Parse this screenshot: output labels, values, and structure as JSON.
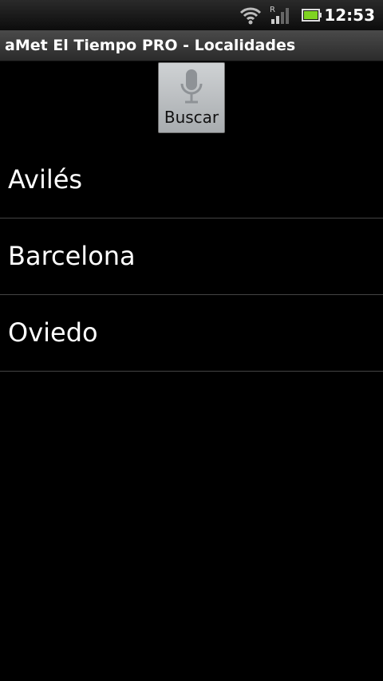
{
  "status_bar": {
    "time": "12:53",
    "icons": [
      "wifi-icon",
      "signal-icon",
      "battery-icon"
    ],
    "signal_label": "R"
  },
  "title_bar": {
    "title": "aMet El Tiempo PRO - Localidades"
  },
  "search": {
    "label": "Buscar",
    "icon": "microphone-icon"
  },
  "locations": [
    {
      "name": "Avilés"
    },
    {
      "name": "Barcelona"
    },
    {
      "name": "Oviedo"
    }
  ],
  "colors": {
    "background": "#000000",
    "divider": "#444444",
    "button_top": "#cfd2d4",
    "button_bottom": "#a8acaf",
    "battery": "#7fd321"
  }
}
